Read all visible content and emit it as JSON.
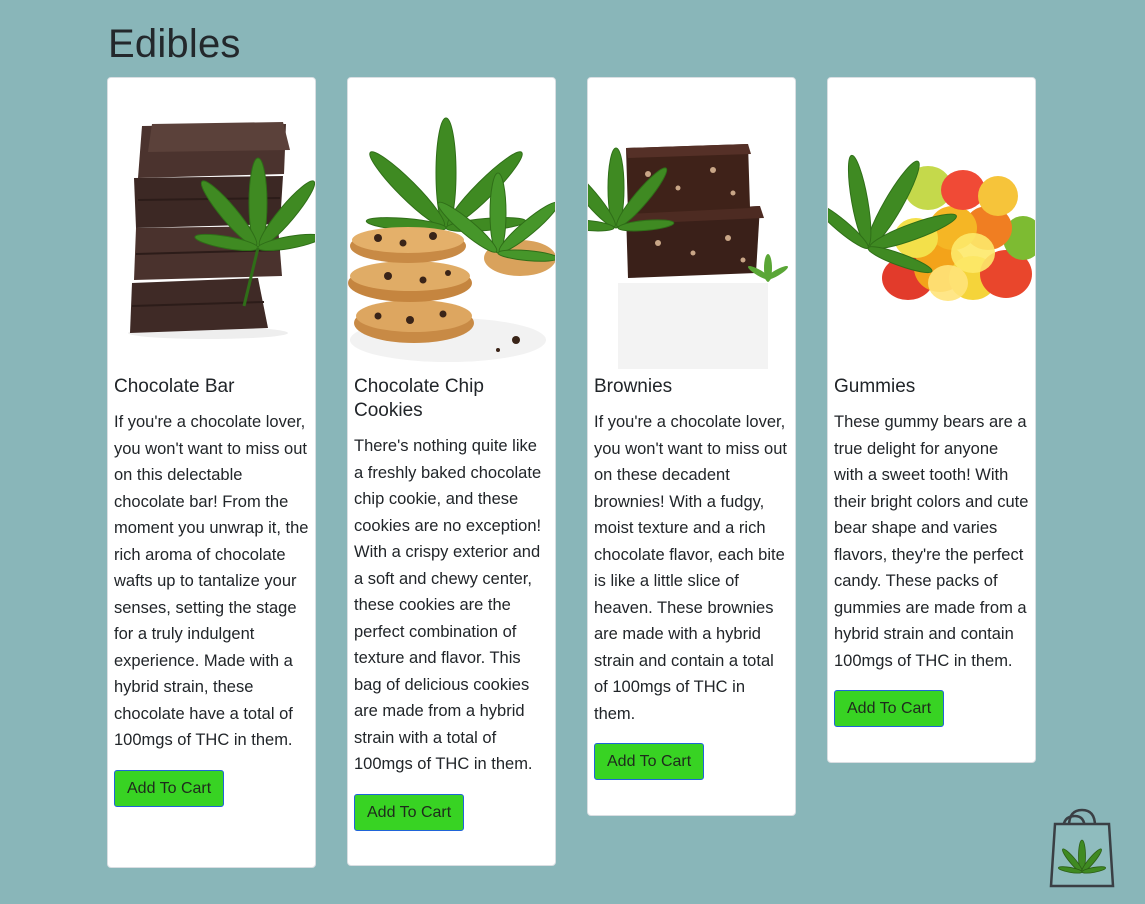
{
  "page": {
    "title": "Edibles"
  },
  "products": [
    {
      "name": "Chocolate Bar",
      "description": "If you're a chocolate lover, you won't want to miss out on this delectable chocolate bar! From the moment you unwrap it, the rich aroma of chocolate wafts up to tantalize your senses, setting the stage for a truly indulgent experience. Made with a hybrid strain, these chocolate have a total of 100mgs of THC in them.",
      "button": "Add To Cart"
    },
    {
      "name": "Chocolate Chip Cookies",
      "description": "There's nothing quite like a freshly baked chocolate chip cookie, and these cookies are no exception! With a crispy exterior and a soft and chewy center, these cookies are the perfect combination of texture and flavor. This bag of delicious cookies are made from a hybrid strain with a total of 100mgs of THC in them.",
      "button": "Add To Cart"
    },
    {
      "name": "Brownies",
      "description": "If you're a chocolate lover, you won't want to miss out on these decadent brownies! With a fudgy, moist texture and a rich chocolate flavor, each bite is like a little slice of heaven. These brownies are made with a hybrid strain and contain a total of 100mgs of THC in them.",
      "button": "Add To Cart"
    },
    {
      "name": "Gummies",
      "description": "These gummy bears are a true delight for anyone with a sweet tooth! With their bright colors and cute bear shape and varies flavors, they're the perfect candy. These packs of gummies are made from a hybrid strain and contain 100mgs of THC in them.",
      "button": "Add To Cart"
    }
  ],
  "icons": {
    "cart": "shopping-bag-cannabis-icon",
    "leaf": "cannabis-leaf-icon"
  },
  "colors": {
    "background": "#89b6b9",
    "button": "#38d323",
    "button_border": "#1f64d8",
    "leaf": "#3f8a22"
  }
}
